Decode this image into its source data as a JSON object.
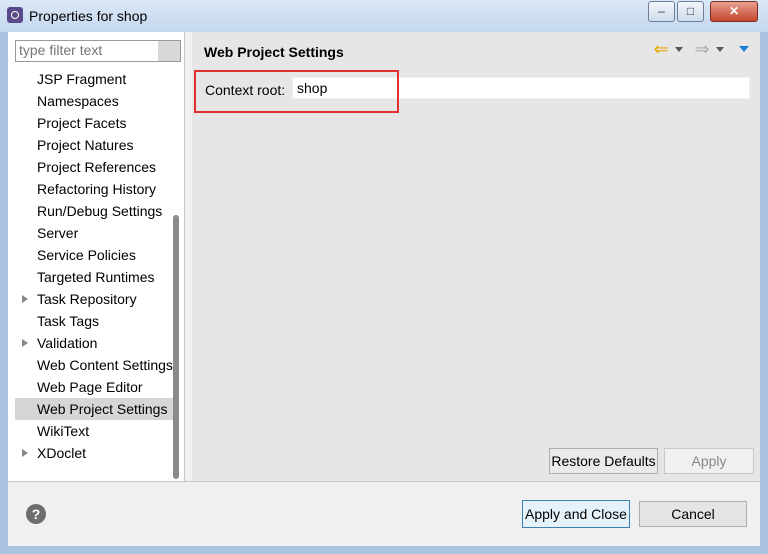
{
  "window": {
    "title": "Properties for shop",
    "controls": {
      "minimize": "–",
      "maximize": "□",
      "close": "✕"
    }
  },
  "left": {
    "filter_placeholder": "type filter text",
    "tree": [
      {
        "label": "JSP Fragment",
        "expandable": false,
        "selected": false
      },
      {
        "label": "Namespaces",
        "expandable": false,
        "selected": false
      },
      {
        "label": "Project Facets",
        "expandable": false,
        "selected": false
      },
      {
        "label": "Project Natures",
        "expandable": false,
        "selected": false
      },
      {
        "label": "Project References",
        "expandable": false,
        "selected": false
      },
      {
        "label": "Refactoring History",
        "expandable": false,
        "selected": false
      },
      {
        "label": "Run/Debug Settings",
        "expandable": false,
        "selected": false
      },
      {
        "label": "Server",
        "expandable": false,
        "selected": false
      },
      {
        "label": "Service Policies",
        "expandable": false,
        "selected": false
      },
      {
        "label": "Targeted Runtimes",
        "expandable": false,
        "selected": false
      },
      {
        "label": "Task Repository",
        "expandable": true,
        "selected": false
      },
      {
        "label": "Task Tags",
        "expandable": false,
        "selected": false
      },
      {
        "label": "Validation",
        "expandable": true,
        "selected": false
      },
      {
        "label": "Web Content Settings",
        "expandable": false,
        "selected": false
      },
      {
        "label": "Web Page Editor",
        "expandable": false,
        "selected": false
      },
      {
        "label": "Web Project Settings",
        "expandable": false,
        "selected": true
      },
      {
        "label": "WikiText",
        "expandable": false,
        "selected": false
      },
      {
        "label": "XDoclet",
        "expandable": true,
        "selected": false
      }
    ]
  },
  "page": {
    "title": "Web Project Settings",
    "context_root_label": "Context root:",
    "context_root_value": "shop",
    "restore_defaults": "Restore Defaults",
    "apply": "Apply"
  },
  "footer": {
    "help": "?",
    "apply_and_close": "Apply and Close",
    "cancel": "Cancel"
  },
  "colors": {
    "highlight": "#e03030",
    "back_arrow": "#e8a800",
    "menu_arrow": "#1e7fd8"
  }
}
